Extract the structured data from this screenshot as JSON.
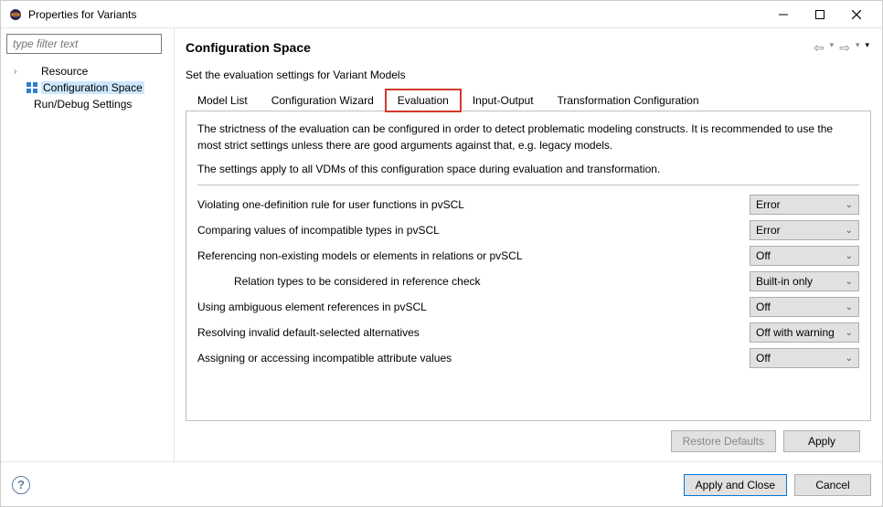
{
  "titlebar": {
    "title": "Properties for Variants"
  },
  "sidebar": {
    "filter_placeholder": "type filter text",
    "items": [
      {
        "label": "Resource"
      },
      {
        "label": "Configuration Space"
      },
      {
        "label": "Run/Debug Settings"
      }
    ]
  },
  "main": {
    "heading": "Configuration Space",
    "subheading": "Set the evaluation settings for Variant Models",
    "tabs": [
      {
        "label": "Model List"
      },
      {
        "label": "Configuration Wizard"
      },
      {
        "label": "Evaluation"
      },
      {
        "label": "Input-Output"
      },
      {
        "label": "Transformation Configuration"
      }
    ],
    "panel": {
      "desc1": "The strictness of the evaluation can be configured in order to detect problematic modeling constructs. It is recommended to use the most strict settings unless there are good arguments against that, e.g. legacy models.",
      "desc2": "The settings apply to all VDMs of this configuration space during evaluation and transformation.",
      "settings": [
        {
          "label": "Violating one-definition rule for user functions in pvSCL",
          "value": "Error"
        },
        {
          "label": "Comparing values of incompatible types in pvSCL",
          "value": "Error"
        },
        {
          "label": "Referencing non-existing models or elements in relations or pvSCL",
          "value": "Off"
        },
        {
          "label": "Relation types to be considered in reference check",
          "value": "Built-in only"
        },
        {
          "label": "Using ambiguous element references in pvSCL",
          "value": "Off"
        },
        {
          "label": "Resolving invalid default-selected alternatives",
          "value": "Off with warning"
        },
        {
          "label": "Assigning or accessing incompatible attribute values",
          "value": "Off"
        }
      ]
    },
    "buttons": {
      "restore": "Restore Defaults",
      "apply": "Apply"
    }
  },
  "footer": {
    "apply_close": "Apply and Close",
    "cancel": "Cancel"
  }
}
